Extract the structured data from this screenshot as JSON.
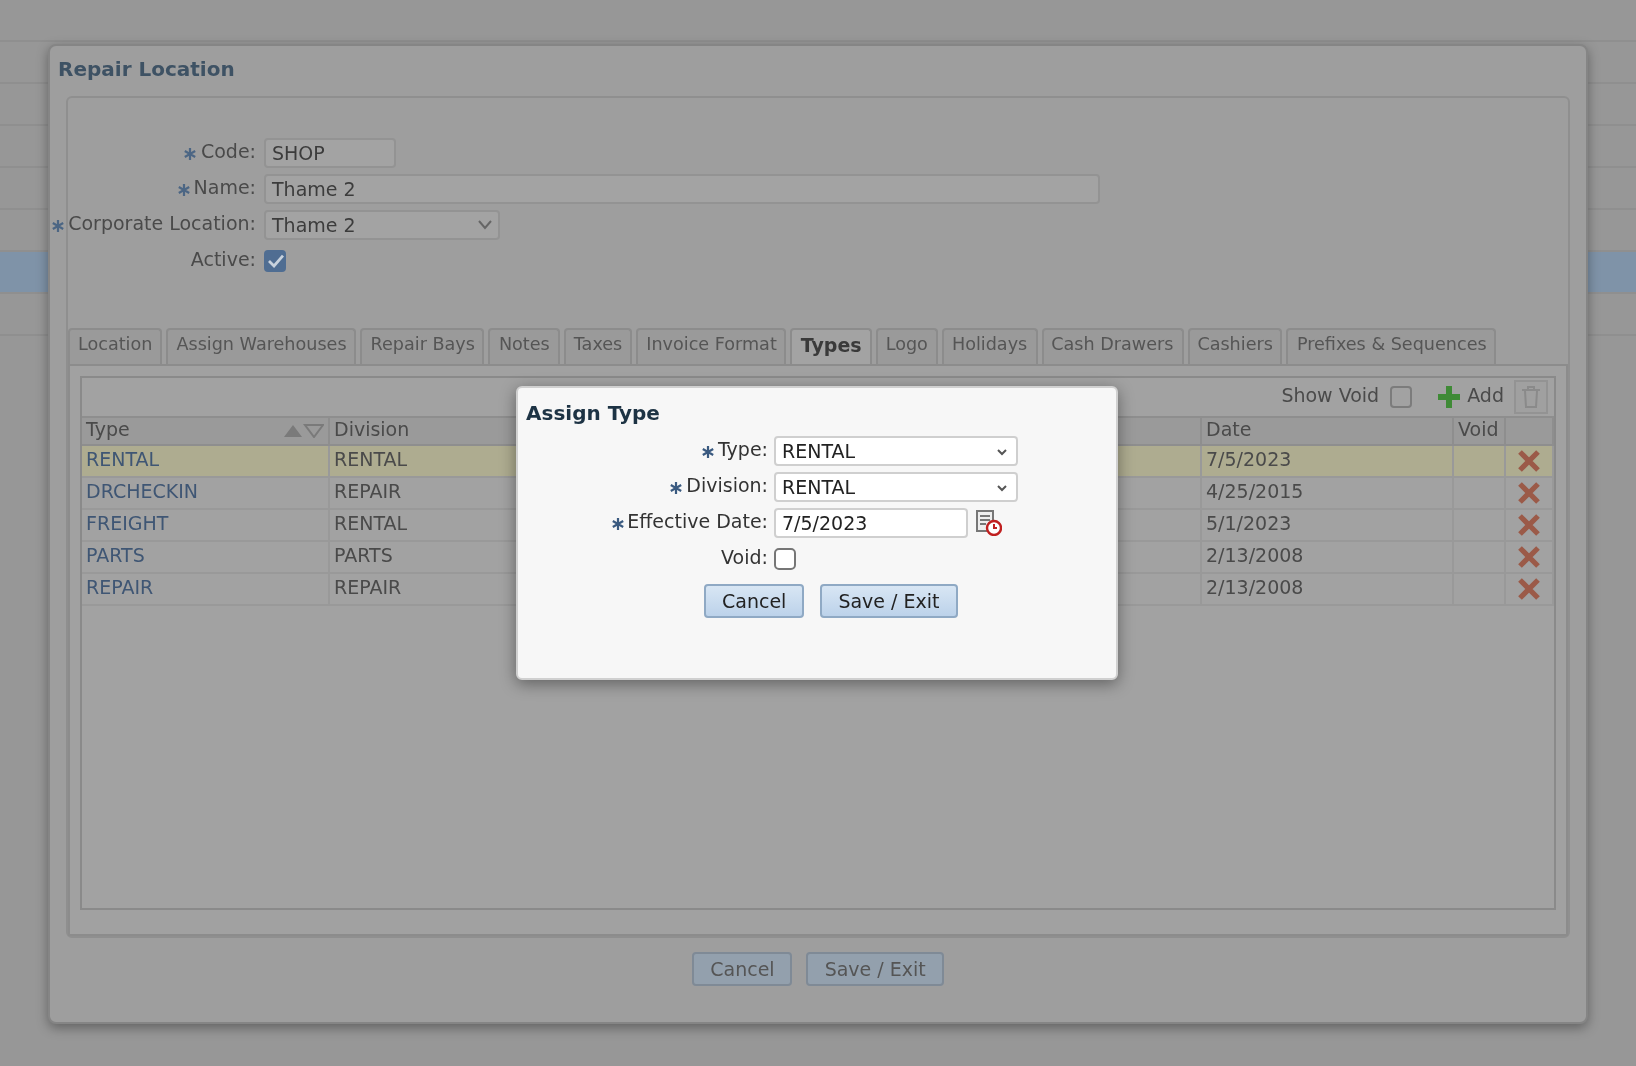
{
  "window": {
    "title": "Repair Location"
  },
  "form": {
    "fields": [
      {
        "kind": "text",
        "label": "Code:",
        "required": true,
        "value": "SHOP"
      },
      {
        "kind": "wide",
        "label": "Name:",
        "required": true,
        "value": "Thame 2"
      },
      {
        "kind": "select",
        "label": "Corporate Location:",
        "required": true,
        "value": "Thame 2"
      },
      {
        "kind": "checkbox",
        "label": "Active:",
        "required": false,
        "checked": true
      }
    ]
  },
  "tabs": [
    {
      "label": "Location",
      "selected": false
    },
    {
      "label": "Assign Warehouses",
      "selected": false
    },
    {
      "label": "Repair Bays",
      "selected": false
    },
    {
      "label": "Notes",
      "selected": false
    },
    {
      "label": "Taxes",
      "selected": false
    },
    {
      "label": "Invoice Format",
      "selected": false
    },
    {
      "label": "Types",
      "selected": true
    },
    {
      "label": "Logo",
      "selected": false
    },
    {
      "label": "Holidays",
      "selected": false
    },
    {
      "label": "Cash Drawers",
      "selected": false
    },
    {
      "label": "Cashiers",
      "selected": false
    },
    {
      "label": "Prefixes & Sequences",
      "selected": false
    }
  ],
  "grid": {
    "show_void": {
      "label": "Show Void",
      "checked": false
    },
    "add_label": "Add",
    "columns": [
      "Type",
      "Division",
      "Date",
      "Void"
    ],
    "rows": [
      {
        "type": "RENTAL",
        "division": "RENTAL",
        "date": "7/5/2023",
        "selected": true
      },
      {
        "type": "DRCHECKIN",
        "division": "REPAIR",
        "date": "4/25/2015",
        "selected": false
      },
      {
        "type": "FREIGHT",
        "division": "RENTAL",
        "date": "5/1/2023",
        "selected": false
      },
      {
        "type": "PARTS",
        "division": "PARTS",
        "date": "2/13/2008",
        "selected": false
      },
      {
        "type": "REPAIR",
        "division": "REPAIR",
        "date": "2/13/2008",
        "selected": false
      }
    ]
  },
  "footer_buttons": [
    "Cancel",
    "Save / Exit"
  ],
  "dialog": {
    "title": "Assign Type",
    "fields": [
      {
        "kind": "select",
        "label": "Type:",
        "required": true,
        "value": "RENTAL"
      },
      {
        "kind": "select",
        "label": "Division:",
        "required": true,
        "value": "RENTAL"
      },
      {
        "kind": "date",
        "label": "Effective Date:",
        "required": true,
        "value": "7/5/2023"
      },
      {
        "kind": "checkbox",
        "label": "Void:",
        "required": false,
        "checked": false
      }
    ],
    "buttons": [
      "Cancel",
      "Save / Exit"
    ]
  }
}
